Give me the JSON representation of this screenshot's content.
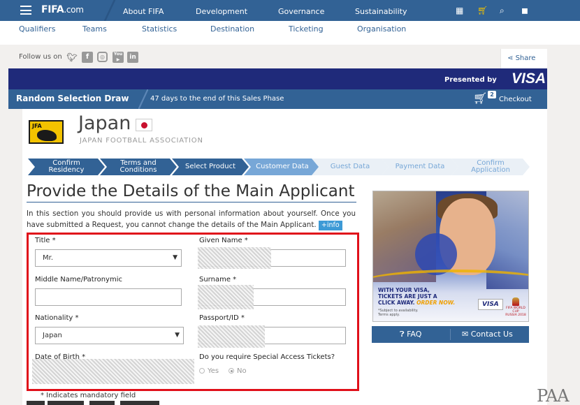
{
  "header": {
    "brand": "FIFA",
    "brand_suffix": ".com",
    "nav": [
      "About FIFA",
      "Development",
      "Governance",
      "Sustainability"
    ],
    "icons": [
      "calendar-icon",
      "cart-icon",
      "search-icon",
      "user-icon"
    ]
  },
  "subnav": [
    "Qualifiers",
    "Teams",
    "Statistics",
    "Destination",
    "Ticketing",
    "Organisation"
  ],
  "social": {
    "follow_label": "Follow us on",
    "networks": [
      "twitter-icon",
      "facebook-icon",
      "instagram-icon",
      "youtube-icon",
      "linkedin-icon"
    ],
    "youtube_text": "You",
    "share_label": "Share"
  },
  "sponsor": {
    "presented_label": "Presented by",
    "brand": "VISA"
  },
  "draw_bar": {
    "title": "Random Selection Draw",
    "days_text": "47 days to the end of this Sales Phase",
    "cart_count": "2",
    "checkout_label": "Checkout"
  },
  "team": {
    "badge_text": "JFA",
    "country": "Japan",
    "association": "JAPAN FOOTBALL ASSOCIATION"
  },
  "steps": [
    {
      "label": "Confirm Residency",
      "state": "done"
    },
    {
      "label": "Terms and Conditions",
      "state": "done"
    },
    {
      "label": "Select Product",
      "state": "current"
    },
    {
      "label": "Customer Data",
      "state": "active"
    },
    {
      "label": "Guest Data",
      "state": "todo"
    },
    {
      "label": "Payment Data",
      "state": "todo"
    },
    {
      "label": "Confirm Application",
      "state": "todo"
    }
  ],
  "form": {
    "heading": "Provide the Details of the Main Applicant",
    "intro": "In this section you should provide us with personal information about yourself. Once you have submitted a Request, you cannot change the details of the Main Applicant.",
    "info_button": "+info",
    "title_label": "Title *",
    "title_value": "Mr.",
    "given_name_label": "Given Name *",
    "middle_name_label": "Middle Name/Patronymic",
    "surname_label": "Surname *",
    "nationality_label": "Nationality *",
    "nationality_value": "Japan",
    "passport_label": "Passport/ID *",
    "dob_label": "Date of Birth *",
    "special_access_label": "Do you require Special Access Tickets?",
    "option_yes": "Yes",
    "option_no": "No",
    "selected_option": "No",
    "mandatory_note": "* Indicates mandatory field"
  },
  "ad": {
    "line1": "WITH YOUR VISA,",
    "line2": "TICKETS ARE JUST A",
    "line3": "CLICK AWAY.",
    "line3_em": "ORDER NOW.",
    "fine1": "*Subject to availability.",
    "fine2": "Terms apply.",
    "logo": "VISA",
    "event_line1": "FIFA WORLD CUP",
    "event_line2": "RUSSIA",
    "event_line3": "2018"
  },
  "help": {
    "faq_label": "FAQ",
    "contact_label": "Contact Us"
  },
  "watermark": "PAA"
}
